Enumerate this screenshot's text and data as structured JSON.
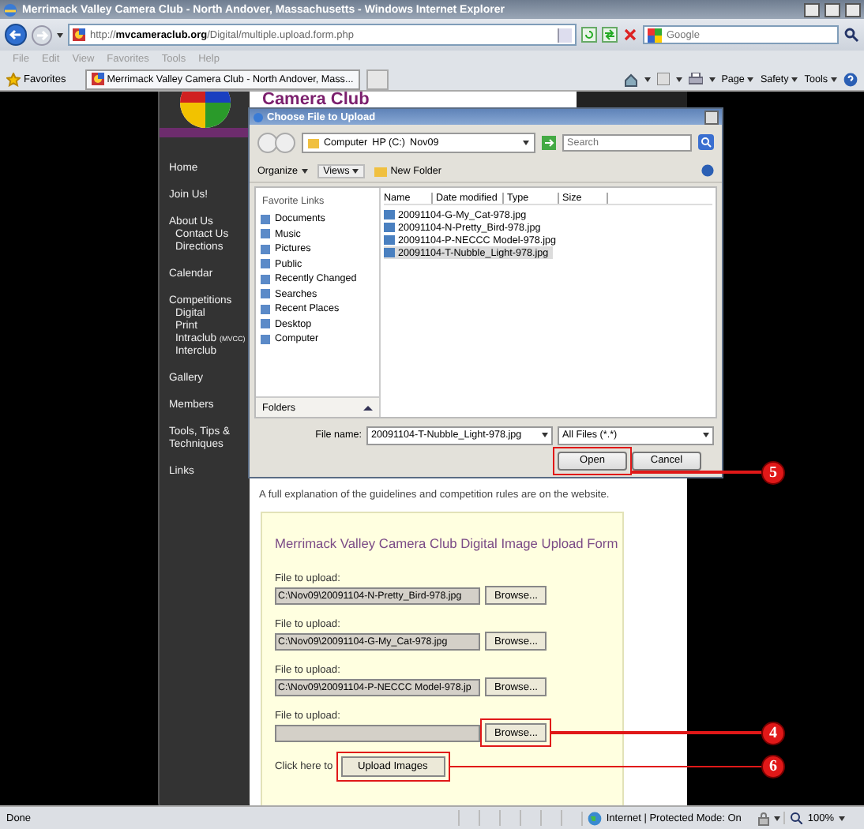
{
  "window": {
    "title": "Merrimack Valley Camera Club - North Andover, Massachusetts - Windows Internet Explorer"
  },
  "address_bar": {
    "url": "http://**mvcameraclub.org**/Digital/multiple.upload.form.php",
    "search_placeholder": "Google"
  },
  "menu": [
    "File",
    "Edit",
    "View",
    "Favorites",
    "Tools",
    "Help"
  ],
  "favorites_bar": {
    "label": "Favorites",
    "tab": "Merrimack Valley Camera Club - North Andover, Mass...",
    "commands": [
      "Page",
      "Safety",
      "Tools"
    ]
  },
  "site": {
    "banner": "Camera Club",
    "nav": [
      {
        "label": "Home"
      },
      {
        "label": "Join Us!"
      },
      {
        "label": "About Us",
        "children": [
          {
            "label": "Contact Us"
          },
          {
            "label": "Directions"
          }
        ]
      },
      {
        "label": "Calendar"
      },
      {
        "label": "Competitions",
        "children": [
          {
            "label": "Digital"
          },
          {
            "label": "Print"
          },
          {
            "label": "Intraclub",
            "note": "(MVCC)"
          },
          {
            "label": "Interclub"
          }
        ]
      },
      {
        "label": "Gallery"
      },
      {
        "label": "Members"
      },
      {
        "label": "Tools, Tips & Techniques"
      },
      {
        "label": "Links"
      }
    ]
  },
  "dialog": {
    "title": "Choose File to Upload",
    "breadcrumb": [
      "Computer",
      "HP (C:)",
      "Nov09"
    ],
    "search_placeholder": "Search",
    "toolbar": [
      "Organize",
      "Views",
      "New Folder"
    ],
    "favorite_links_heading": "Favorite Links",
    "favorite_links": [
      "Documents",
      "Music",
      "Pictures",
      "Public",
      "Recently Changed",
      "Searches",
      "Recent Places",
      "Desktop",
      "Computer"
    ],
    "columns": [
      "Name",
      "Date modified",
      "Type",
      "Size"
    ],
    "files": [
      {
        "name": "20091104-G-My_Cat-978.jpg",
        "selected": false
      },
      {
        "name": "20091104-N-Pretty_Bird-978.jpg",
        "selected": false
      },
      {
        "name": "20091104-P-NECCC Model-978.jpg",
        "selected": false
      },
      {
        "name": "20091104-T-Nubble_Light-978.jpg",
        "selected": true
      }
    ],
    "folders_label": "Folders",
    "file_name_label": "File name:",
    "file_name": "20091104-T-Nubble_Light-978.jpg",
    "file_type": "All Files (*.*)",
    "buttons": [
      {
        "label": "Open",
        "callout": "5"
      },
      {
        "label": "Cancel"
      }
    ]
  },
  "page": {
    "intro": "A full explanation of the guidelines and competition rules are on the website.",
    "form": {
      "title": "Merrimack Valley Camera Club Digital Image Upload Form",
      "rows": [
        {
          "label": "File to upload:",
          "value": "C:\\Nov09\\20091104-N-Pretty_Bird-978.jpg",
          "button": "Browse..."
        },
        {
          "label": "File to upload:",
          "value": "C:\\Nov09\\20091104-G-My_Cat-978.jpg",
          "button": "Browse..."
        },
        {
          "label": "File to upload:",
          "value": "C:\\Nov09\\20091104-P-NECCC Model-978.jp",
          "button": "Browse..."
        },
        {
          "label": "File to upload:",
          "button": "Browse...",
          "callout": "4"
        }
      ],
      "submit_prompt": "Click here to",
      "submit": "Upload Images",
      "submit_callout": "6"
    }
  },
  "status_bar": {
    "text": "Done",
    "zone": "Internet | Protected Mode: On",
    "zoom": "100%"
  }
}
